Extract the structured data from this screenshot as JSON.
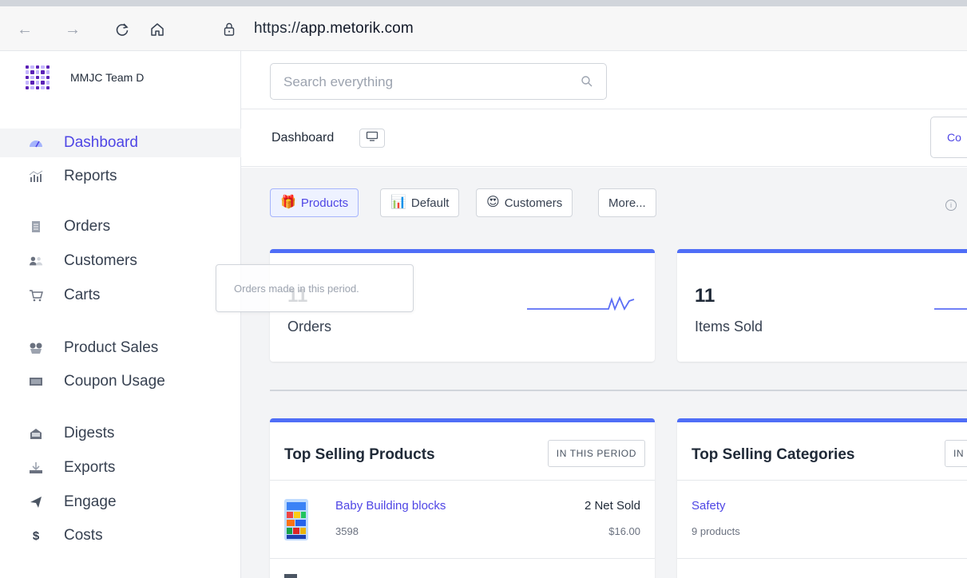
{
  "browser": {
    "url_scheme": "https://",
    "url_host": "app.metorik.com"
  },
  "team": {
    "name": "MMJC Team D"
  },
  "search": {
    "placeholder": "Search everything"
  },
  "sidebar": {
    "items": [
      {
        "label": "Dashboard",
        "icon": "dashboard-icon",
        "active": true
      },
      {
        "label": "Reports",
        "icon": "reports-icon"
      },
      {
        "label": "Orders",
        "icon": "orders-icon"
      },
      {
        "label": "Customers",
        "icon": "customers-icon"
      },
      {
        "label": "Carts",
        "icon": "cart-icon"
      },
      {
        "label": "Product Sales",
        "icon": "product-sales-icon"
      },
      {
        "label": "Coupon Usage",
        "icon": "coupon-icon"
      },
      {
        "label": "Digests",
        "icon": "digests-icon"
      },
      {
        "label": "Exports",
        "icon": "exports-icon"
      },
      {
        "label": "Engage",
        "icon": "engage-icon"
      },
      {
        "label": "Costs",
        "icon": "costs-icon"
      }
    ]
  },
  "page": {
    "title": "Dashboard",
    "right_button": "Co"
  },
  "filters": [
    {
      "label": "Products",
      "emoji": "🎁",
      "active": true
    },
    {
      "label": "Default",
      "emoji": "📊"
    },
    {
      "label": "Customers",
      "emoji": "😍"
    },
    {
      "label": "More..."
    }
  ],
  "stats": [
    {
      "value": "11",
      "label": "Orders"
    },
    {
      "value": "11",
      "label": "Items Sold"
    }
  ],
  "tooltip": {
    "text": "Orders made in this period."
  },
  "top_products": {
    "title": "Top Selling Products",
    "badge": "IN THIS PERIOD",
    "rows": [
      {
        "name": "Baby Building blocks",
        "sku": "3598",
        "sold_value": "2",
        "sold_label": "Net Sold",
        "amount": "$16.00"
      }
    ]
  },
  "top_categories": {
    "title": "Top Selling Categories",
    "badge": "IN",
    "rows": [
      {
        "name": "Safety",
        "count": "9 products"
      }
    ]
  },
  "colors": {
    "accent": "#4f46e5",
    "card_top": "#4f6ef7"
  }
}
